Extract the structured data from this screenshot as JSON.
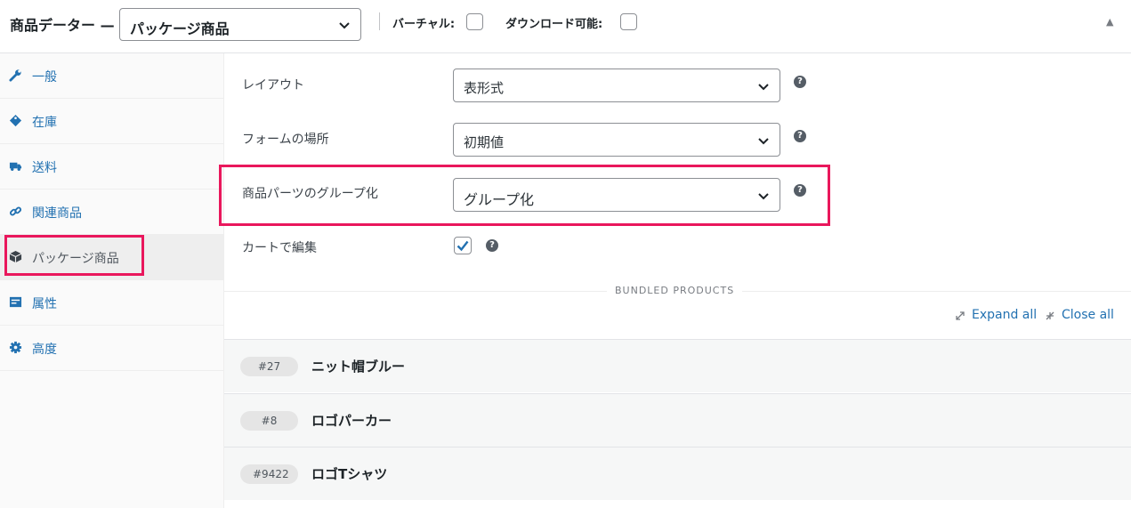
{
  "header": {
    "title": "商品データー —",
    "product_type": "パッケージ商品",
    "virtual_label": "バーチャル:",
    "downloadable_label": "ダウンロード可能:",
    "collapse_glyph": "▲"
  },
  "sidebar": {
    "items": [
      {
        "label": "一般",
        "icon": "wrench-icon"
      },
      {
        "label": "在庫",
        "icon": "tag-icon"
      },
      {
        "label": "送料",
        "icon": "truck-icon"
      },
      {
        "label": "関連商品",
        "icon": "link-icon"
      },
      {
        "label": "パッケージ商品",
        "icon": "box-icon",
        "active": true
      },
      {
        "label": "属性",
        "icon": "list-icon"
      },
      {
        "label": "高度",
        "icon": "gear-icon"
      }
    ]
  },
  "fields": {
    "layout": {
      "label": "レイアウト",
      "value": "表形式"
    },
    "form_location": {
      "label": "フォームの場所",
      "value": "初期値"
    },
    "grouping": {
      "label": "商品パーツのグループ化",
      "value": "グループ化"
    },
    "edit_in_cart": {
      "label": "カートで編集",
      "checked": true
    }
  },
  "help_glyph": "?",
  "bundled": {
    "section_label": "BUNDLED PRODUCTS",
    "expand_all": "Expand all",
    "close_all": "Close all",
    "items": [
      {
        "id": "#27",
        "name": "ニット帽ブルー"
      },
      {
        "id": "#8",
        "name": "ロゴパーカー"
      },
      {
        "id": "#9422",
        "name": "ロゴTシャツ"
      }
    ]
  },
  "colors": {
    "accent": "#2271b1",
    "highlight": "#e9175c",
    "check": "#2271b1"
  }
}
